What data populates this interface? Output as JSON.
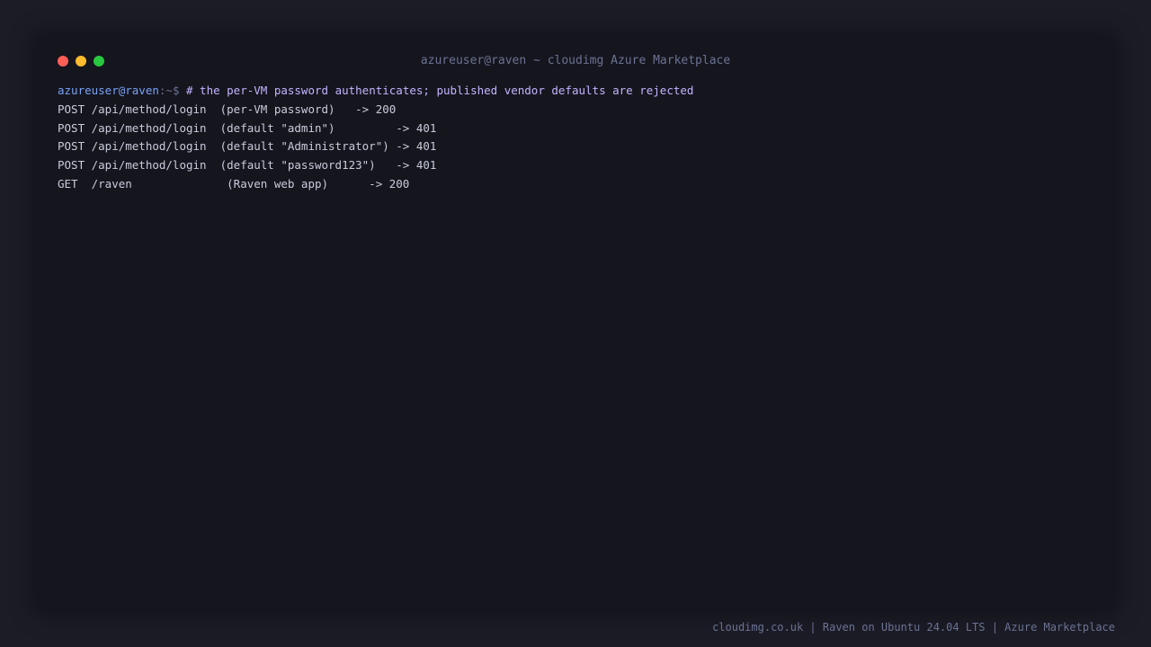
{
  "window": {
    "title": "azureuser@raven ~ cloudimg Azure Marketplace"
  },
  "terminal": {
    "prompt_user": "azureuser@raven",
    "prompt_path": ":~$ ",
    "command": "# the per-VM password authenticates; published vendor defaults are rejected",
    "output": [
      "POST /api/method/login  (per-VM password)   -> 200",
      "POST /api/method/login  (default \"admin\")         -> 401",
      "POST /api/method/login  (default \"Administrator\") -> 401",
      "POST /api/method/login  (default \"password123\")   -> 401",
      "GET  /raven              (Raven web app)      -> 200"
    ]
  },
  "footer": {
    "text": "cloudimg.co.uk | Raven on Ubuntu 24.04 LTS | Azure Marketplace"
  },
  "colors": {
    "background": "#1c1c27",
    "window": "#15151e",
    "close": "#ff5f57",
    "minimize": "#febc2e",
    "maximize": "#28c840",
    "prompt_user": "#7aa2f7",
    "command": "#c3b4ff",
    "text": "#c9ccda",
    "muted": "#6b7392"
  }
}
